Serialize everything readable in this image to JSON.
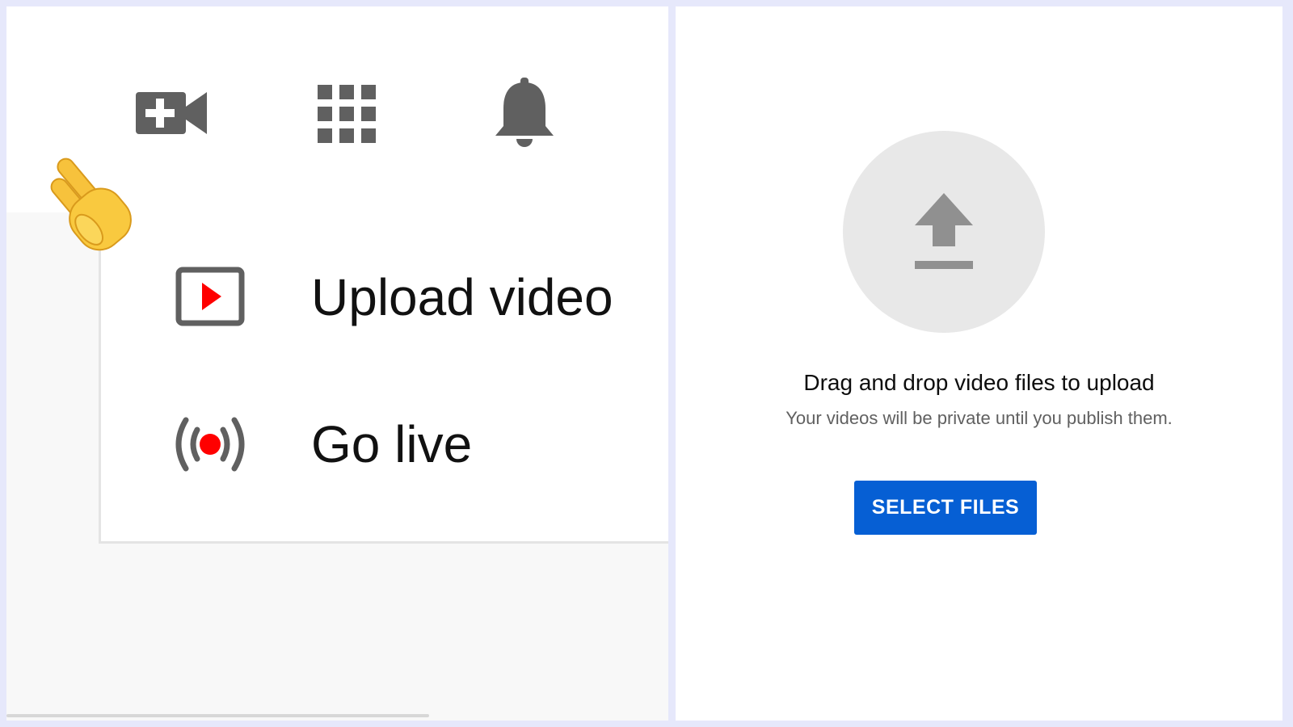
{
  "header": {
    "icons": [
      "video-camera-plus-icon",
      "apps-grid-icon",
      "notifications-bell-icon"
    ]
  },
  "create_menu": {
    "items": [
      {
        "label": "Upload video",
        "icon": "upload-video-icon"
      },
      {
        "label": "Go live",
        "icon": "go-live-icon"
      }
    ]
  },
  "pointer": {
    "icon": "pointing-hand-icon"
  },
  "upload_dialog": {
    "icon": "upload-arrow-icon",
    "title": "Drag and drop video files to upload",
    "subtitle": "Your videos will be private until you publish them.",
    "button_label": "SELECT FILES"
  },
  "colors": {
    "accent_blue": "#065fd4",
    "live_red": "#ff0000",
    "icon_gray": "#606060",
    "frame": "#e6e8fb"
  }
}
